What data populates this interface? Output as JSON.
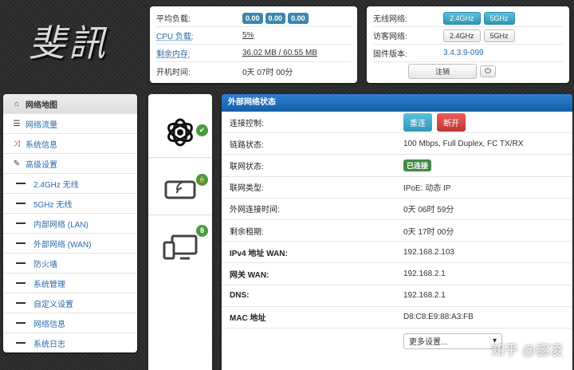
{
  "brand": {
    "logo_text": "斐訊"
  },
  "status": {
    "load": {
      "label": "平均负载:",
      "values": [
        "0.00",
        "0.00",
        "0.00"
      ]
    },
    "cpu": {
      "label": "CPU 负载:",
      "value": "5%"
    },
    "mem": {
      "label": "剩余内存:",
      "value": "36.02 MB / 60.55 MB"
    },
    "uptime": {
      "label": "开机时间:",
      "value": "0天 07时 00分"
    }
  },
  "wireless": {
    "wifi": {
      "label": "无线网络:",
      "b1": "2.4GHz",
      "b2": "5GHz"
    },
    "guest": {
      "label": "访客网络:",
      "b1": "2.4GHz",
      "b2": "5GHz"
    },
    "firmware": {
      "label": "固件版本:",
      "value": "3.4.3.9-099"
    },
    "logout": "注销",
    "power_icon": "power-icon"
  },
  "sidebar": {
    "items": [
      {
        "label": "网络地图",
        "icon": "home-icon"
      },
      {
        "label": "网络流量",
        "icon": "list-icon"
      },
      {
        "label": "系统信息",
        "icon": "shuffle-icon"
      },
      {
        "label": "高级设置",
        "icon": "wrench-icon"
      }
    ],
    "sub": [
      {
        "label": "2.4GHz 无线"
      },
      {
        "label": "5GHz 无线"
      },
      {
        "label": "内部网络 (LAN)"
      },
      {
        "label": "外部网络 (WAN)"
      },
      {
        "label": "防火墙"
      },
      {
        "label": "系统管理"
      },
      {
        "label": "自定义设置"
      },
      {
        "label": "网络信息"
      },
      {
        "label": "系统日志"
      }
    ]
  },
  "mid": {
    "items": [
      {
        "icon": "internet-globe-icon",
        "badge": "✔"
      },
      {
        "icon": "wireless-device-icon",
        "badge": "🔒"
      },
      {
        "icon": "clients-icon",
        "badge": "8"
      }
    ]
  },
  "wan": {
    "header": "外部网络状态",
    "control": {
      "label": "连接控制:",
      "reconnect": "重连",
      "disconnect": "断开"
    },
    "link": {
      "label": "链路状态:",
      "value": "100 Mbps, Full Duplex, FC TX/RX"
    },
    "net": {
      "label": "联网状态:",
      "value": "已连接"
    },
    "type": {
      "label": "联网类型:",
      "value": "IPoE: 动态 IP"
    },
    "conn_time": {
      "label": "外网连接时间:",
      "value": "0天 06时 59分"
    },
    "lease": {
      "label": "剩余租期:",
      "value": "0天 17时 00分"
    },
    "ipv4": {
      "label": "IPv4 地址 WAN:",
      "value": "192.168.2.103"
    },
    "gateway": {
      "label": "网关 WAN:",
      "value": "192.168.2.1"
    },
    "dns": {
      "label": "DNS:",
      "value": "192.168.2.1"
    },
    "mac": {
      "label": "MAC 地址",
      "value": "D8:C8:E9:88:A3:FB"
    },
    "more": "更多设置..."
  },
  "watermark": "知乎 @鋆凌"
}
